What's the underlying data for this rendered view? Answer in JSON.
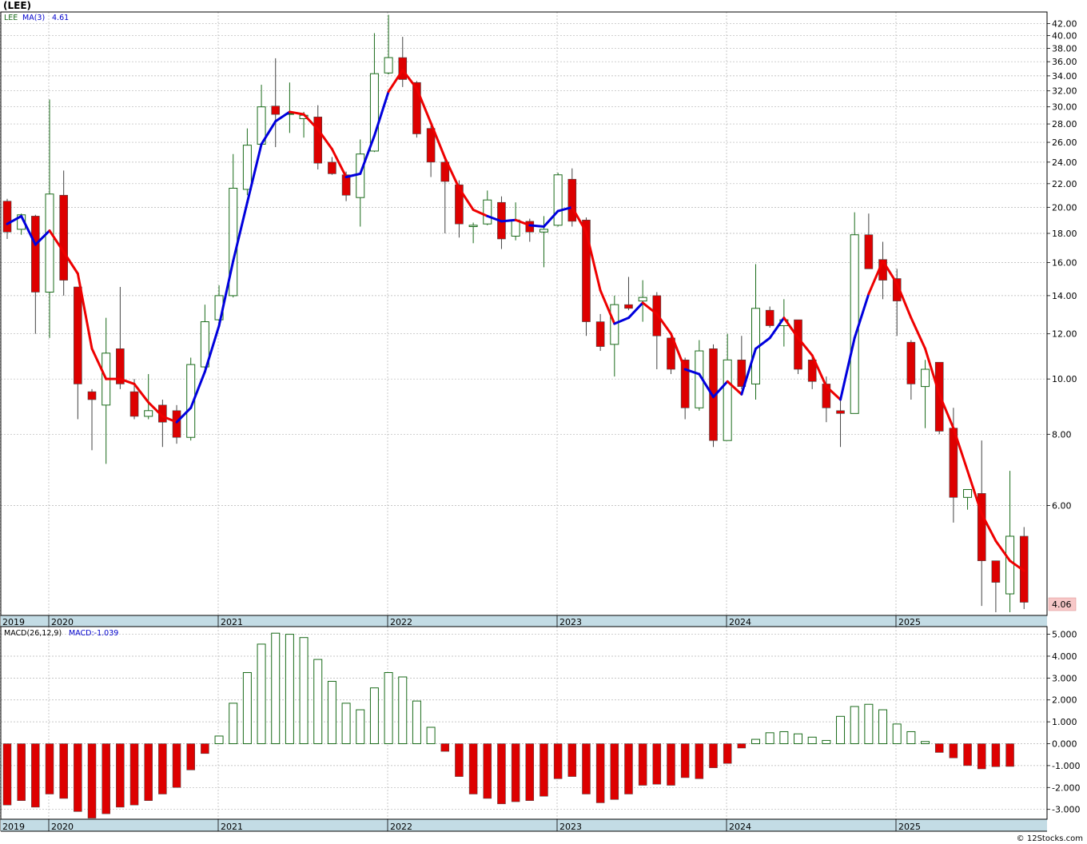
{
  "title": "(LEE)",
  "watermark": "© 12Stocks.com",
  "colors": {
    "up": "#1a6b1a",
    "down": "#dd0000",
    "ma_up": "#0000dd",
    "ma_down": "#ee0000",
    "grid": "#b4b4b4",
    "axis_band": "#c3dce5",
    "last_bg": "#f7c8c8"
  },
  "chart_data": [
    {
      "type": "candlestick",
      "title": "(LEE)",
      "legend": {
        "symbol": "LEE",
        "ma_label": "MA(3)",
        "ma_value": "4.61"
      },
      "y_scale": "log",
      "ylim": [
        3.85,
        44
      ],
      "grid": true,
      "y_ticks": [
        6,
        8,
        10,
        12,
        14,
        16,
        18,
        20,
        22,
        24,
        26,
        28,
        30,
        32,
        34,
        36,
        38,
        40,
        42
      ],
      "y_tick_labels": [
        "6.00",
        "8.00",
        "10.00",
        "12.00",
        "14.00",
        "16.00",
        "18.00",
        "20.00",
        "22.00",
        "24.00",
        "26.00",
        "28.00",
        "30.00",
        "32.00",
        "34.00",
        "36.00",
        "38.00",
        "40.00",
        "42.00"
      ],
      "x_labels": [
        "2019",
        "2020",
        "2021",
        "2022",
        "2023",
        "2024",
        "2025"
      ],
      "last_price": "4.06",
      "ohlc": [
        [
          20.5,
          20.7,
          17.6,
          18.1
        ],
        [
          18.3,
          19.5,
          17.9,
          19.4
        ],
        [
          19.3,
          19.4,
          12.0,
          14.2
        ],
        [
          14.2,
          30.9,
          11.8,
          21.1
        ],
        [
          21.0,
          23.2,
          14.0,
          14.9
        ],
        [
          14.5,
          14.5,
          8.5,
          9.8
        ],
        [
          9.5,
          9.6,
          7.5,
          9.2
        ],
        [
          9.0,
          12.8,
          7.1,
          11.1
        ],
        [
          11.3,
          14.5,
          9.6,
          9.8
        ],
        [
          9.5,
          10.0,
          8.5,
          8.6
        ],
        [
          8.6,
          10.2,
          8.5,
          8.8
        ],
        [
          9.0,
          9.2,
          7.6,
          8.4
        ],
        [
          8.8,
          9.0,
          7.7,
          7.9
        ],
        [
          7.9,
          10.9,
          7.8,
          10.6
        ],
        [
          10.5,
          13.5,
          10.4,
          12.6
        ],
        [
          12.7,
          14.6,
          12.6,
          14.0
        ],
        [
          14.0,
          24.8,
          13.9,
          21.6
        ],
        [
          21.5,
          27.5,
          21.0,
          25.7
        ],
        [
          25.8,
          32.8,
          25.6,
          30.0
        ],
        [
          30.1,
          36.5,
          25.5,
          29.1
        ],
        [
          29.2,
          33.1,
          27.0,
          29.2
        ],
        [
          28.6,
          29.4,
          26.5,
          29.0
        ],
        [
          28.8,
          30.2,
          23.3,
          23.9
        ],
        [
          24.0,
          24.5,
          22.8,
          22.9
        ],
        [
          22.8,
          23.1,
          20.5,
          21.0
        ],
        [
          20.8,
          26.3,
          18.5,
          24.8
        ],
        [
          25.1,
          40.4,
          25.0,
          34.3
        ],
        [
          34.4,
          43.5,
          34.2,
          36.6
        ],
        [
          36.6,
          39.8,
          32.5,
          33.5
        ],
        [
          33.1,
          33.3,
          26.5,
          26.9
        ],
        [
          27.5,
          27.8,
          22.6,
          24.0
        ],
        [
          24.0,
          24.5,
          18.0,
          22.2
        ],
        [
          21.9,
          22.3,
          17.7,
          18.7
        ],
        [
          18.5,
          18.8,
          17.3,
          18.6
        ],
        [
          18.7,
          21.4,
          18.6,
          20.6
        ],
        [
          20.4,
          20.9,
          16.9,
          17.6
        ],
        [
          17.8,
          20.4,
          17.5,
          19.0
        ],
        [
          18.9,
          19.1,
          17.4,
          18.1
        ],
        [
          18.1,
          19.3,
          15.7,
          18.3
        ],
        [
          18.6,
          23.0,
          18.5,
          22.8
        ],
        [
          22.4,
          23.4,
          18.5,
          18.9
        ],
        [
          19.0,
          19.2,
          11.9,
          12.6
        ],
        [
          12.6,
          13.0,
          11.2,
          11.4
        ],
        [
          11.5,
          14.0,
          10.1,
          13.5
        ],
        [
          13.5,
          15.1,
          13.2,
          13.3
        ],
        [
          13.7,
          14.9,
          12.6,
          13.9
        ],
        [
          14.0,
          14.2,
          10.4,
          11.9
        ],
        [
          11.8,
          12.0,
          10.2,
          10.4
        ],
        [
          10.8,
          10.9,
          8.5,
          8.9
        ],
        [
          8.9,
          11.7,
          8.8,
          11.2
        ],
        [
          11.3,
          11.5,
          7.6,
          7.8
        ],
        [
          7.8,
          12.0,
          7.8,
          10.8
        ],
        [
          10.8,
          11.9,
          9.6,
          9.7
        ],
        [
          9.8,
          15.9,
          9.2,
          13.3
        ],
        [
          13.2,
          13.4,
          12.3,
          12.4
        ],
        [
          12.4,
          13.8,
          11.4,
          12.7
        ],
        [
          12.7,
          12.7,
          10.2,
          10.4
        ],
        [
          10.8,
          11.0,
          9.6,
          9.9
        ],
        [
          9.8,
          10.1,
          8.4,
          8.9
        ],
        [
          8.8,
          9.2,
          7.6,
          8.7
        ],
        [
          8.7,
          19.6,
          8.7,
          17.9
        ],
        [
          17.9,
          19.5,
          15.6,
          15.6
        ],
        [
          16.2,
          17.4,
          13.8,
          14.9
        ],
        [
          15.0,
          15.6,
          11.9,
          13.7
        ],
        [
          11.6,
          11.7,
          9.2,
          9.8
        ],
        [
          9.7,
          10.8,
          8.2,
          10.4
        ],
        [
          10.7,
          10.7,
          8.0,
          8.1
        ],
        [
          8.2,
          8.9,
          5.6,
          6.2
        ],
        [
          6.2,
          6.3,
          5.9,
          6.4
        ],
        [
          6.3,
          7.8,
          4.0,
          4.8
        ],
        [
          4.8,
          4.8,
          3.9,
          4.4
        ],
        [
          4.2,
          6.9,
          3.9,
          5.3
        ],
        [
          5.3,
          5.5,
          3.95,
          4.06
        ]
      ],
      "ma3": [
        18.7,
        19.3,
        17.2,
        18.2,
        16.7,
        15.3,
        11.3,
        10.0,
        10.0,
        9.8,
        9.1,
        8.6,
        8.4,
        8.9,
        10.3,
        12.4,
        16.1,
        20.4,
        25.8,
        28.3,
        29.4,
        29.1,
        27.4,
        25.3,
        22.6,
        22.9,
        26.7,
        31.9,
        34.8,
        32.3,
        28.1,
        24.4,
        21.6,
        19.8,
        19.3,
        18.9,
        19.0,
        18.6,
        18.5,
        19.7,
        20.0,
        18.1,
        14.3,
        12.5,
        12.8,
        13.6,
        13.0,
        12.0,
        10.4,
        10.2,
        9.3,
        9.9,
        9.4,
        11.3,
        11.8,
        12.8,
        11.8,
        11.0,
        9.7,
        9.2,
        11.8,
        14.1,
        16.1,
        14.7,
        12.8,
        11.3,
        9.4,
        8.2,
        6.9,
        5.8,
        5.2,
        4.8,
        4.61
      ],
      "ma_direction": [
        "up",
        "up",
        "up",
        "up",
        "down",
        "down",
        "down",
        "down",
        "down",
        "down",
        "down",
        "down",
        "down",
        "up",
        "up",
        "up",
        "up",
        "up",
        "up",
        "up",
        "up",
        "down",
        "down",
        "down",
        "down",
        "up",
        "up",
        "up",
        "down",
        "down",
        "down",
        "down",
        "down",
        "down",
        "down",
        "up",
        "up",
        "down",
        "up",
        "up",
        "up",
        "down",
        "down",
        "down",
        "up",
        "up",
        "down",
        "down",
        "down",
        "up",
        "up",
        "up",
        "down",
        "up",
        "up",
        "up",
        "down",
        "down",
        "down",
        "down",
        "up",
        "up",
        "down",
        "down",
        "down",
        "down",
        "down",
        "down",
        "down",
        "down",
        "down",
        "down",
        "down"
      ]
    },
    {
      "type": "bar",
      "title": "MACD(26,12,9)",
      "legend": {
        "label": "MACD(26,12,9)",
        "value_label": "MACD:-1.039"
      },
      "ylim": [
        -3.45,
        5.35
      ],
      "grid": true,
      "y_ticks": [
        -3,
        -2,
        -1,
        0,
        1,
        2,
        3,
        4,
        5
      ],
      "y_tick_labels": [
        "-3.000",
        "-2.000",
        "-1.000",
        "0.000",
        "1.000",
        "2.000",
        "3.000",
        "4.000",
        "5.000"
      ],
      "x_labels": [
        "2019",
        "2020",
        "2021",
        "2022",
        "2023",
        "2024",
        "2025"
      ],
      "values": [
        -2.8,
        -2.6,
        -2.9,
        -2.3,
        -2.5,
        -3.1,
        -3.4,
        -3.2,
        -2.9,
        -2.8,
        -2.6,
        -2.3,
        -2.0,
        -1.2,
        -0.45,
        0.35,
        1.85,
        3.25,
        4.55,
        5.05,
        5.0,
        4.85,
        3.85,
        2.85,
        1.85,
        1.55,
        2.55,
        3.25,
        3.05,
        1.95,
        0.75,
        -0.35,
        -1.5,
        -2.3,
        -2.5,
        -2.75,
        -2.65,
        -2.6,
        -2.4,
        -1.6,
        -1.5,
        -2.3,
        -2.7,
        -2.55,
        -2.3,
        -1.9,
        -1.85,
        -1.9,
        -1.55,
        -1.6,
        -1.1,
        -0.9,
        -0.2,
        0.2,
        0.5,
        0.55,
        0.45,
        0.3,
        0.15,
        1.25,
        1.7,
        1.8,
        1.55,
        0.9,
        0.55,
        0.1,
        -0.4,
        -0.65,
        -1.0,
        -1.15,
        -1.05,
        -1.039
      ],
      "colors": [
        "down",
        "down",
        "down",
        "down",
        "down",
        "down",
        "down",
        "down",
        "down",
        "down",
        "down",
        "down",
        "down",
        "down",
        "down",
        "up",
        "up",
        "up",
        "up",
        "up",
        "up",
        "up",
        "up",
        "up",
        "up",
        "up",
        "up",
        "up",
        "up",
        "up",
        "up",
        "down",
        "down",
        "down",
        "down",
        "down",
        "down",
        "down",
        "down",
        "down",
        "down",
        "down",
        "down",
        "down",
        "down",
        "down",
        "down",
        "down",
        "down",
        "down",
        "down",
        "down",
        "down",
        "up",
        "up",
        "up",
        "up",
        "up",
        "up",
        "up",
        "up",
        "up",
        "up",
        "up",
        "up",
        "up",
        "down",
        "down",
        "down",
        "down",
        "down",
        "down"
      ]
    }
  ]
}
